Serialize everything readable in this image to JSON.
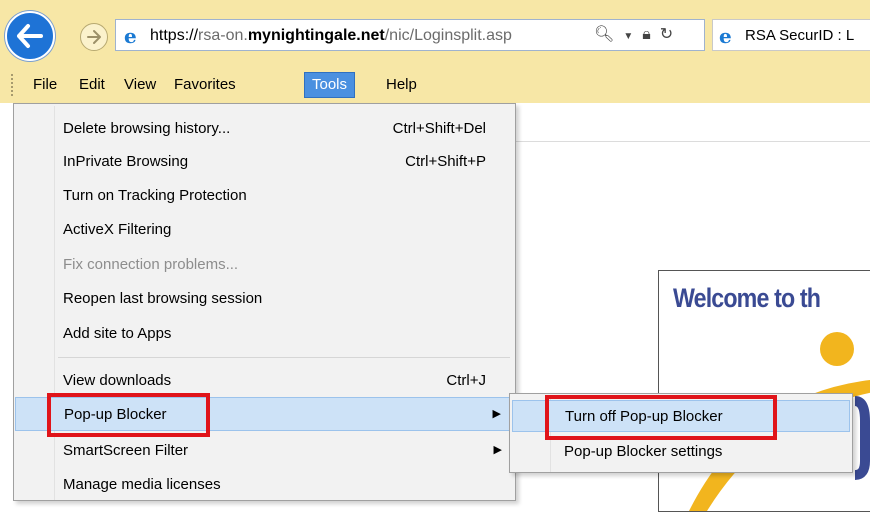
{
  "address_bar": {
    "url_protocol": "https://",
    "url_subdomain": "rsa-on.",
    "url_domain": "mynightingale.net",
    "url_path": "/nic/Loginsplit.asp"
  },
  "tab": {
    "title": "RSA SecurID : L"
  },
  "menubar": {
    "items": [
      {
        "label": "File"
      },
      {
        "label": "Edit"
      },
      {
        "label": "View"
      },
      {
        "label": "Favorites"
      },
      {
        "label": "Tools"
      },
      {
        "label": "Help"
      }
    ]
  },
  "tools_menu": {
    "items": [
      {
        "label": "Delete browsing history...",
        "shortcut": "Ctrl+Shift+Del"
      },
      {
        "label": "InPrivate Browsing",
        "shortcut": "Ctrl+Shift+P"
      },
      {
        "label": "Turn on Tracking Protection"
      },
      {
        "label": "ActiveX Filtering"
      },
      {
        "label": "Fix connection problems..."
      },
      {
        "label": "Reopen last browsing session"
      },
      {
        "label": "Add site to Apps"
      },
      {
        "label": "View downloads",
        "shortcut": "Ctrl+J"
      },
      {
        "label": "Pop-up Blocker"
      },
      {
        "label": "SmartScreen Filter"
      },
      {
        "label": "Manage media licenses"
      }
    ]
  },
  "popup_submenu": {
    "items": [
      {
        "label": "Turn off Pop-up Blocker"
      },
      {
        "label": "Pop-up Blocker settings"
      }
    ]
  },
  "page": {
    "welcome_text": "Welcome to th"
  },
  "colors": {
    "chrome_bg": "#f7e7a6",
    "menu_active": "#4a90e0",
    "hover_bg": "#cde2f7",
    "highlight_red": "#e0141a",
    "welcome_text": "#3a4a93"
  }
}
